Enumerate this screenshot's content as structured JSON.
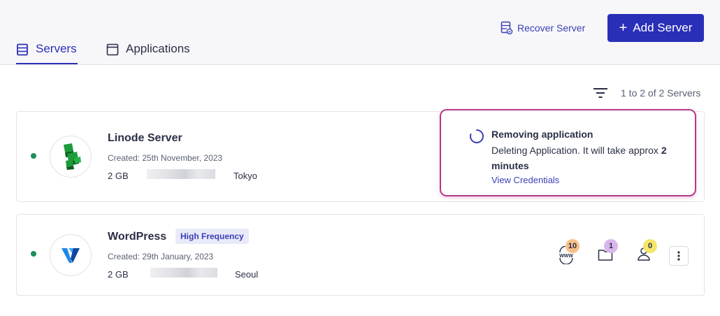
{
  "tabs": [
    {
      "label": "Servers",
      "active": true,
      "icon": "server-list-icon"
    },
    {
      "label": "Applications",
      "active": false,
      "icon": "window-icon"
    }
  ],
  "header": {
    "recover_label": "Recover Server",
    "add_label": "Add Server"
  },
  "list": {
    "count_text": "1 to 2 of 2 Servers"
  },
  "servers": [
    {
      "name": "Linode Server",
      "created": "Created: 25th November, 2023",
      "size": "2 GB",
      "location": "Tokyo",
      "status_color": "#1a8f5a",
      "provider_icon": "linode-logo"
    },
    {
      "name": "WordPress",
      "badge": "High Frequency",
      "created": "Created: 29th January, 2023",
      "size": "2 GB",
      "location": "Seoul",
      "status_color": "#1a8f5a",
      "provider_icon": "vultr-logo",
      "stats": {
        "websites": "10",
        "folders": "1",
        "users": "0"
      }
    }
  ],
  "notification": {
    "title": "Removing application",
    "message": "Deleting Application. It will take approx ",
    "duration": "2 minutes",
    "link": "View Credentials"
  },
  "colors": {
    "primary": "#2a2fb8",
    "status_online": "#1a8f5a",
    "highlight_border": "#b8388a",
    "badge_orange": "#f7c08a",
    "badge_purple": "#d9b6ec",
    "badge_yellow": "#f4e56a"
  }
}
